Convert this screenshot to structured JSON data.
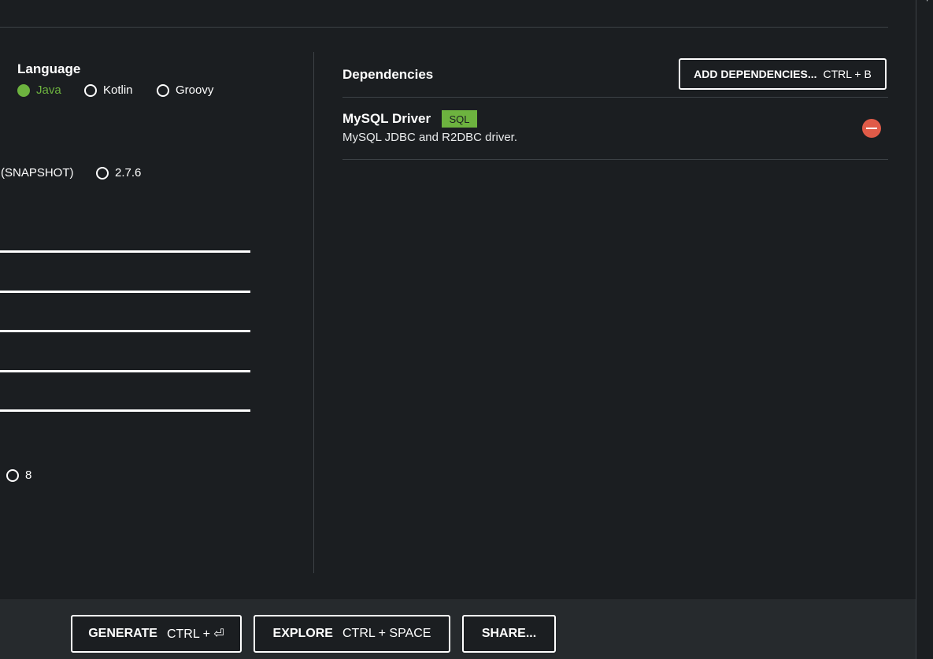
{
  "language": {
    "title": "Language",
    "options": [
      {
        "label": "Java",
        "selected": true
      },
      {
        "label": "Kotlin",
        "selected": false
      },
      {
        "label": "Groovy",
        "selected": false
      }
    ]
  },
  "spring_boot": {
    "partial_label": "(SNAPSHOT)",
    "options": [
      {
        "label": "2.7.6",
        "selected": false
      }
    ]
  },
  "java_version": {
    "options": [
      {
        "label": "8",
        "selected": false
      }
    ]
  },
  "dependencies": {
    "title": "Dependencies",
    "add_button_label": "ADD DEPENDENCIES...",
    "add_button_shortcut": "CTRL + B",
    "items": [
      {
        "name": "MySQL Driver",
        "tag": "SQL",
        "description": "MySQL JDBC and R2DBC driver."
      }
    ]
  },
  "footer": {
    "generate_label": "GENERATE",
    "generate_shortcut": "CTRL + ⏎",
    "explore_label": "EXPLORE",
    "explore_shortcut": "CTRL + SPACE",
    "share_label": "SHARE..."
  },
  "colors": {
    "background": "#1b1e21",
    "accent": "#6db33f",
    "remove": "#e05b48"
  }
}
